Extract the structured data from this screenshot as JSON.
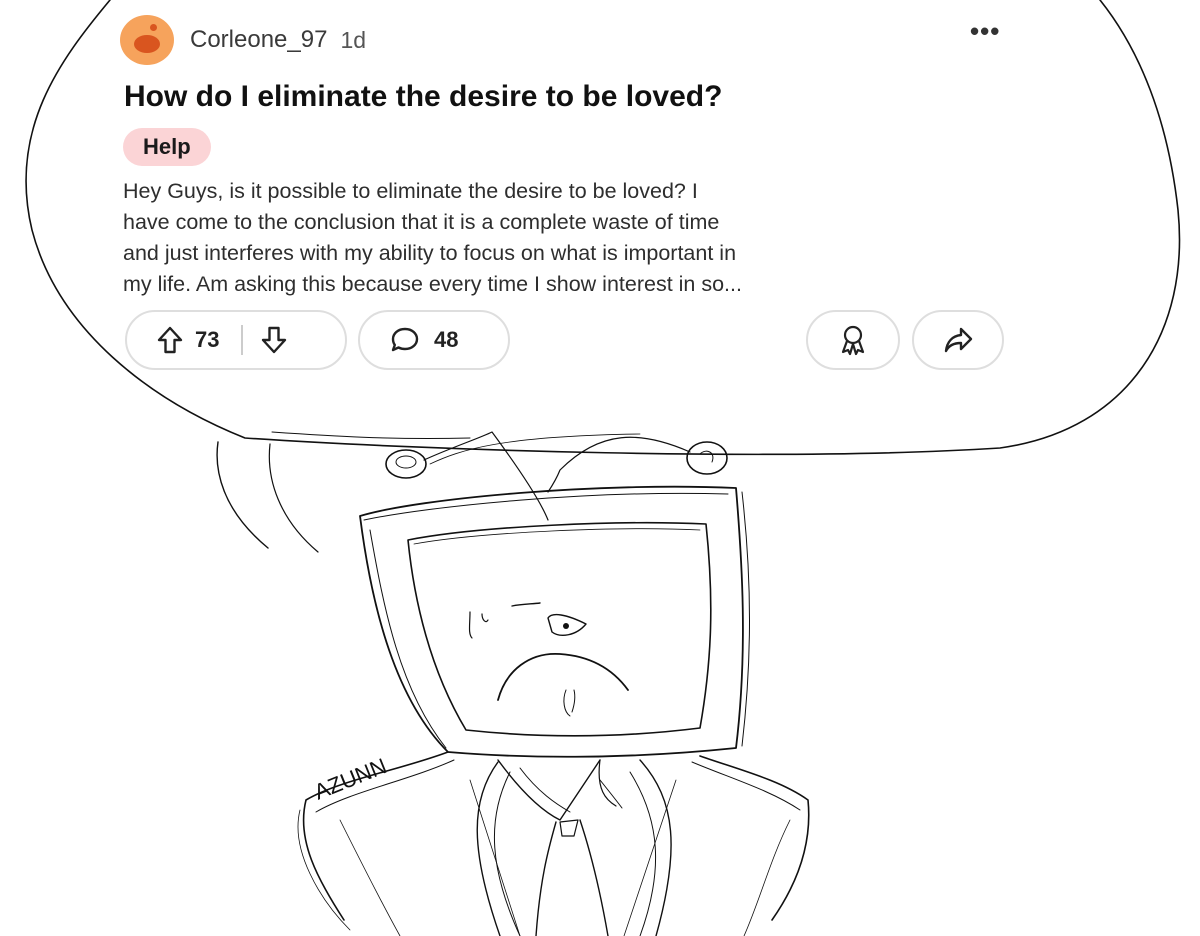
{
  "post": {
    "author": "Corleone_97",
    "age": "1d",
    "more_label": "•••",
    "title": "How do I eliminate the desire to be loved?",
    "flair": "Help",
    "body_lines": [
      "Hey Guys, is it possible to eliminate the desire to be loved? I",
      "have come to the conclusion that it is a complete waste of time",
      "and just interferes with my ability to focus on what is important in",
      "my life. Am asking this because every time I show interest in so..."
    ],
    "votes": "73",
    "comments": "48"
  },
  "icons": {
    "avatar": "reddit-snoo-avatar",
    "more": "more-dots-icon",
    "upvote": "upvote-arrow-icon",
    "downvote": "downvote-arrow-icon",
    "comment": "comment-bubble-icon",
    "award": "award-icon",
    "share": "share-arrow-icon"
  },
  "drawing": {
    "signature": "AZUNN",
    "description_colors": {
      "ink": "#111111",
      "flair_bg": "#fbd4d6",
      "avatar": "#f6a35c"
    }
  }
}
